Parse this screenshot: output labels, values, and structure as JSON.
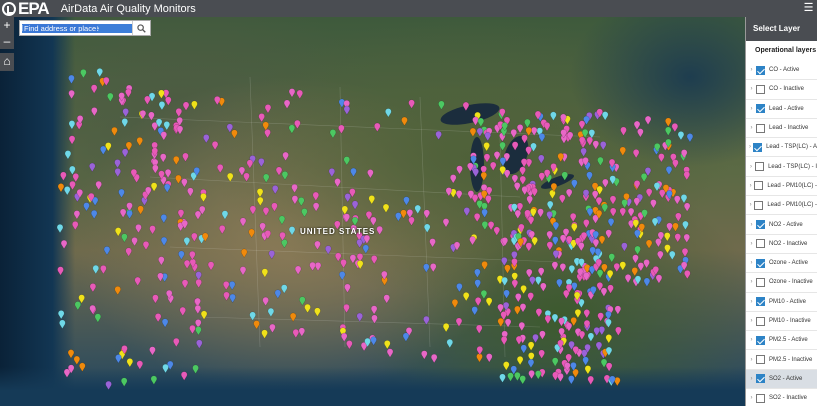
{
  "header": {
    "logo_text": "EPA",
    "title": "AirData Air Quality Monitors",
    "layers_icon": "layers-icon"
  },
  "search": {
    "placeholder": "Find address or place",
    "button_icon": "search-icon"
  },
  "map": {
    "tools": [
      {
        "icon": "zoom-in-icon",
        "glyph": "+"
      },
      {
        "icon": "zoom-out-icon",
        "glyph": "–"
      },
      {
        "icon": "home-icon",
        "glyph": "⌂"
      }
    ],
    "labels": {
      "country": "UNITED STATES"
    },
    "marker_colors": {
      "co": "#f0e21a",
      "lead": "#f08a0c",
      "no2": "#4d88e8",
      "ozone": "#e85ab8",
      "pm10": "#6fd8e8",
      "pm25": "#e867c7",
      "so2": "#9a63d8",
      "other": "#4cc862"
    }
  },
  "panel": {
    "title": "Select Layer",
    "subtitle": "Operational layers",
    "layers": [
      {
        "label": "CO - Active",
        "checked": true
      },
      {
        "label": "CO - Inactive",
        "checked": false
      },
      {
        "label": "Lead - Active",
        "checked": true
      },
      {
        "label": "Lead - Inactive",
        "checked": false
      },
      {
        "label": "Lead - TSP(LC) - A",
        "checked": true
      },
      {
        "label": "Lead - TSP(LC) - I",
        "checked": false
      },
      {
        "label": "Lead - PM10(LC) - ",
        "checked": false
      },
      {
        "label": "Lead - PM10(LC) - ",
        "checked": false
      },
      {
        "label": "NO2 - Active",
        "checked": true
      },
      {
        "label": "NO2 - Inactive",
        "checked": false
      },
      {
        "label": "Ozone - Active",
        "checked": true
      },
      {
        "label": "Ozone - Inactive",
        "checked": false
      },
      {
        "label": "PM10 - Active",
        "checked": true
      },
      {
        "label": "PM10 - Inactive",
        "checked": false
      },
      {
        "label": "PM2.5 - Active",
        "checked": true
      },
      {
        "label": "PM2.5 - Inactive",
        "checked": false
      },
      {
        "label": "SO2 - Active",
        "checked": true,
        "selected": true
      },
      {
        "label": "SO2 - Inactive",
        "checked": false
      }
    ]
  }
}
